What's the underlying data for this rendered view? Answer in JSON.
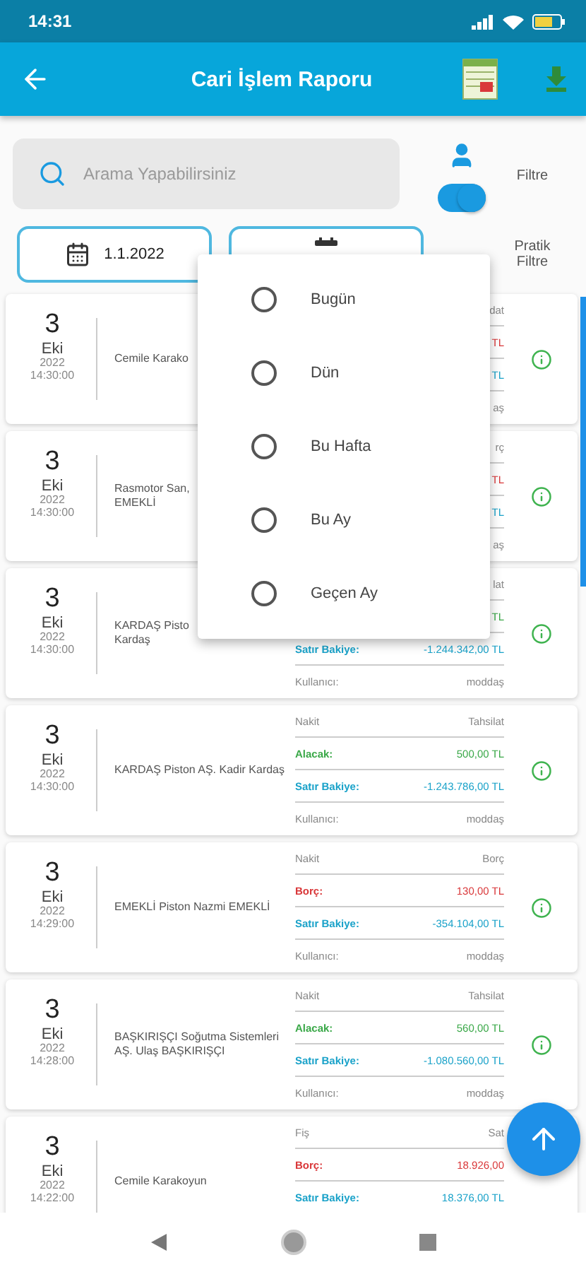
{
  "status_bar": {
    "time": "14:31"
  },
  "app_bar": {
    "title": "Cari İşlem Raporu"
  },
  "search": {
    "placeholder": "Arama Yapabilirsiniz"
  },
  "filter_toggle": {
    "on": true,
    "label": "Filtre"
  },
  "date_filter": {
    "start": "1.1.2022"
  },
  "quick_filter": {
    "label": "Pratik Filtre"
  },
  "records": [
    {
      "day": "3",
      "month": "Eki",
      "year": "2022",
      "time": "14:30:00",
      "name": "Cemile Karako",
      "info_icon": true,
      "rows": [
        {
          "kind": "type",
          "right": "dat"
        },
        {
          "kind": "debit",
          "value": "TL"
        },
        {
          "kind": "balance",
          "value": "TL"
        },
        {
          "kind": "user",
          "right": "aş"
        }
      ]
    },
    {
      "day": "3",
      "month": "Eki",
      "year": "2022",
      "time": "14:30:00",
      "name": "Rasmotor San,\nEMEKLİ",
      "info_icon": true,
      "rows": [
        {
          "kind": "type",
          "right": "rç"
        },
        {
          "kind": "debit",
          "value": "TL"
        },
        {
          "kind": "balance",
          "value": "TL"
        },
        {
          "kind": "user",
          "right": "aş"
        }
      ]
    },
    {
      "day": "3",
      "month": "Eki",
      "year": "2022",
      "time": "14:30:00",
      "name": "KARDAŞ Pisto\nKardaş",
      "info_icon": true,
      "rows": [
        {
          "kind": "type",
          "right": "lat"
        },
        {
          "kind": "credit",
          "value": "TL"
        },
        {
          "kind": "balance",
          "label": "Satır Bakiye:",
          "value": "-1.244.342,00 TL"
        },
        {
          "kind": "user",
          "left": "Kullanıcı:",
          "right": "moddaş"
        }
      ]
    },
    {
      "day": "3",
      "month": "Eki",
      "year": "2022",
      "time": "14:30:00",
      "name": "KARDAŞ Piston AŞ. Kadir Kardaş",
      "info_icon": true,
      "rows": [
        {
          "kind": "type",
          "left": "Nakit",
          "right": "Tahsilat"
        },
        {
          "kind": "credit",
          "label": "Alacak:",
          "value": "500,00 TL"
        },
        {
          "kind": "balance",
          "label": "Satır Bakiye:",
          "value": "-1.243.786,00 TL"
        },
        {
          "kind": "user",
          "left": "Kullanıcı:",
          "right": "moddaş"
        }
      ]
    },
    {
      "day": "3",
      "month": "Eki",
      "year": "2022",
      "time": "14:29:00",
      "name": "EMEKLİ Piston Nazmi EMEKLİ",
      "info_icon": true,
      "rows": [
        {
          "kind": "type",
          "left": "Nakit",
          "right": "Borç"
        },
        {
          "kind": "debit",
          "label": "Borç:",
          "value": "130,00 TL"
        },
        {
          "kind": "balance",
          "label": "Satır Bakiye:",
          "value": "-354.104,00 TL"
        },
        {
          "kind": "user",
          "left": "Kullanıcı:",
          "right": "moddaş"
        }
      ]
    },
    {
      "day": "3",
      "month": "Eki",
      "year": "2022",
      "time": "14:28:00",
      "name": "BAŞKIRIŞÇI Soğutma Sistemleri AŞ. Ulaş BAŞKIRIŞÇI",
      "info_icon": true,
      "rows": [
        {
          "kind": "type",
          "left": "Nakit",
          "right": "Tahsilat"
        },
        {
          "kind": "credit",
          "label": "Alacak:",
          "value": "560,00 TL"
        },
        {
          "kind": "balance",
          "label": "Satır Bakiye:",
          "value": "-1.080.560,00 TL"
        },
        {
          "kind": "user",
          "left": "Kullanıcı:",
          "right": "moddaş"
        }
      ]
    },
    {
      "day": "3",
      "month": "Eki",
      "year": "2022",
      "time": "14:22:00",
      "name": "Cemile Karakoyun",
      "info_icon": false,
      "rows": [
        {
          "kind": "type",
          "left": "Fiş",
          "right": "Sat"
        },
        {
          "kind": "debit",
          "label": "Borç:",
          "value": "18.926,00"
        },
        {
          "kind": "balance",
          "label": "Satır Bakiye:",
          "value": "18.376,00 TL"
        }
      ]
    }
  ],
  "quick_menu": {
    "options": [
      {
        "label": "Bugün",
        "selected": false
      },
      {
        "label": "Dün",
        "selected": false
      },
      {
        "label": "Bu Hafta",
        "selected": false
      },
      {
        "label": "Bu Ay",
        "selected": false
      },
      {
        "label": "Geçen Ay",
        "selected": false
      }
    ]
  }
}
